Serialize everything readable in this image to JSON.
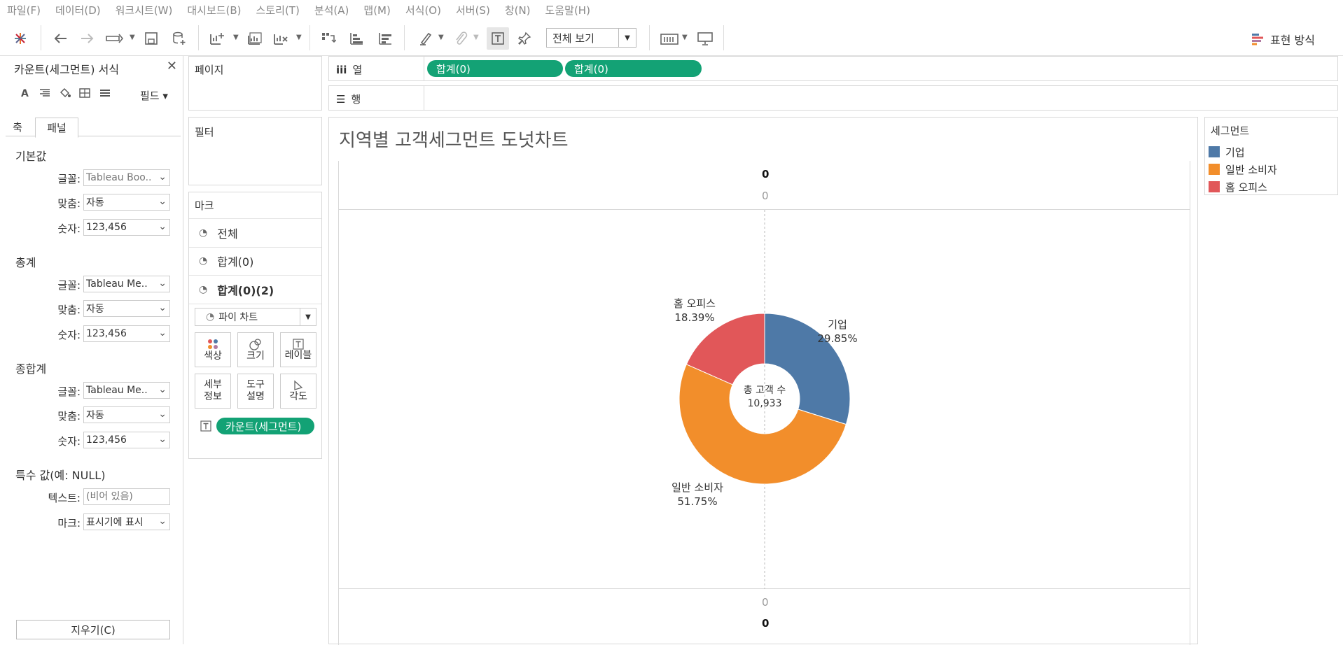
{
  "menu": [
    "파일(F)",
    "데이터(D)",
    "워크시트(W)",
    "대시보드(B)",
    "스토리(T)",
    "분석(A)",
    "맵(M)",
    "서식(O)",
    "서버(S)",
    "창(N)",
    "도움말(H)"
  ],
  "toolbar": {
    "fit_label": "전체 보기",
    "show_me_label": "표현 방식"
  },
  "format_pane": {
    "title": "카운트(세그먼트) 서식",
    "fields_label": "필드",
    "tabs": [
      "축",
      "패널"
    ],
    "sections": [
      {
        "title": "기본값",
        "rows": [
          {
            "label": "글꼴:",
            "value": "Tableau Boo.."
          },
          {
            "label": "맞춤:",
            "value": "자동"
          },
          {
            "label": "숫자:",
            "value": "123,456"
          }
        ]
      },
      {
        "title": "총계",
        "rows": [
          {
            "label": "글꼴:",
            "value": "Tableau Me.."
          },
          {
            "label": "맞춤:",
            "value": "자동"
          },
          {
            "label": "숫자:",
            "value": "123,456"
          }
        ]
      },
      {
        "title": "종합계",
        "rows": [
          {
            "label": "글꼴:",
            "value": "Tableau Me.."
          },
          {
            "label": "맞춤:",
            "value": "자동"
          },
          {
            "label": "숫자:",
            "value": "123,456"
          }
        ]
      }
    ],
    "special": {
      "title": "특수 값(예: NULL)",
      "text_label": "텍스트:",
      "text_placeholder": "(비어 있음)",
      "mark_label": "마크:",
      "mark_value": "표시기에 표시"
    },
    "clear_label": "지우기(C)"
  },
  "pages": {
    "title": "페이지"
  },
  "filters": {
    "title": "필터"
  },
  "marks": {
    "title": "마크",
    "rows": [
      "전체",
      "합계(0)",
      "합계(0)(2)"
    ],
    "type": "파이 차트",
    "buttons": [
      [
        "색상"
      ],
      [
        "크기"
      ],
      [
        "레이블"
      ],
      [
        "세부",
        "정보"
      ],
      [
        "도구",
        "설명"
      ],
      [
        "각도"
      ]
    ],
    "pill": "카운트(세그먼트)"
  },
  "shelves": {
    "columns_label": "열",
    "rows_label": "행",
    "column_pills": [
      "합계(0)",
      "합계(0)"
    ]
  },
  "view": {
    "title": "지역별 고객세그먼트 도넛차트",
    "top_header": "0",
    "top_axis": "0",
    "bottom_axis": "0",
    "bottom_header": "0",
    "center_label_1": "총 고객 수",
    "center_label_2": "10,933"
  },
  "legend": {
    "title": "세그먼트",
    "items": [
      {
        "label": "기업",
        "color": "#4e79a7"
      },
      {
        "label": "일반 소비자",
        "color": "#f28e2b"
      },
      {
        "label": "홈 오피스",
        "color": "#e15759"
      }
    ]
  },
  "chart_data": {
    "type": "pie",
    "title": "지역별 고객세그먼트 도넛차트",
    "categories": [
      "기업",
      "일반 소비자",
      "홈 오피스"
    ],
    "values": [
      29.85,
      51.75,
      18.39
    ],
    "labels": [
      "29.85%",
      "51.75%",
      "18.39%"
    ],
    "colors": [
      "#4e79a7",
      "#f28e2b",
      "#e15759"
    ],
    "donut": true,
    "legend": "right"
  }
}
